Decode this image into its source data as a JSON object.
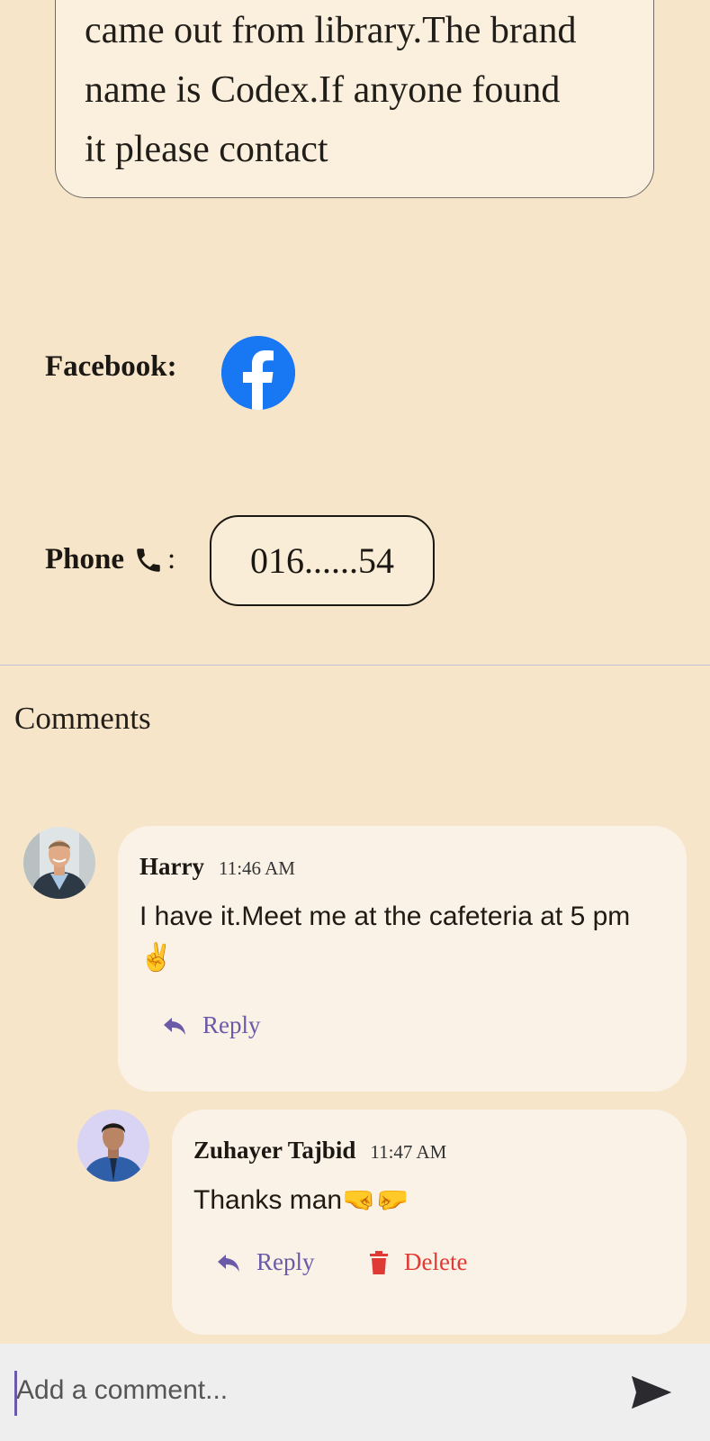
{
  "post": {
    "description_lines": [
      "came out from library.The brand",
      "name is Codex.If anyone found",
      "it please contact"
    ]
  },
  "contact": {
    "facebook_label": "Facebook:",
    "phone_label": "Phone",
    "phone_colon": ":",
    "phone_value": "016......54"
  },
  "comments": {
    "title": "Comments",
    "items": [
      {
        "name": "Harry",
        "time": "11:46 AM",
        "text": "I have it.Meet me at the cafeteria at 5 pm✌️",
        "reply_label": "Reply"
      },
      {
        "name": "Zuhayer Tajbid",
        "time": "11:47 AM",
        "text": "Thanks man🤜🤛",
        "reply_label": "Reply",
        "delete_label": "Delete"
      }
    ]
  },
  "composer": {
    "placeholder": "Add a comment..."
  },
  "colors": {
    "background": "#f7e5c9",
    "facebook": "#1877f2",
    "reply": "#6a5aa8",
    "delete": "#e03a34"
  },
  "icons": [
    "facebook-icon",
    "phone-icon",
    "reply-icon",
    "trash-icon",
    "send-icon"
  ]
}
